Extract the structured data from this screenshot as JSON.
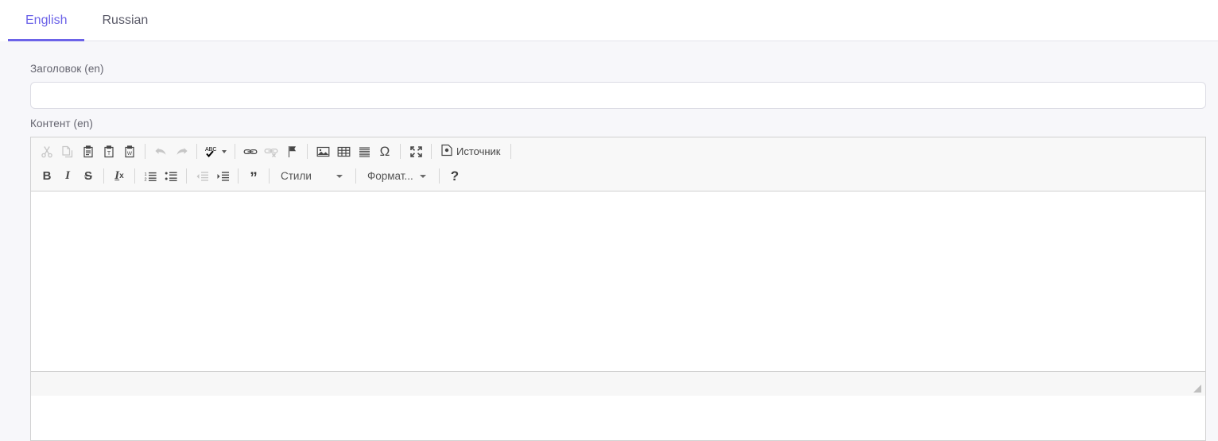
{
  "tabs": [
    {
      "label": "English",
      "active": true
    },
    {
      "label": "Russian",
      "active": false
    }
  ],
  "form": {
    "title_label": "Заголовок (en)",
    "title_value": "",
    "title_placeholder": "",
    "content_label": "Контент (en)"
  },
  "editor": {
    "toolbar_row1": [
      {
        "name": "cut-icon",
        "tooltip": "Вырезать",
        "disabled": true
      },
      {
        "name": "copy-icon",
        "tooltip": "Копировать",
        "disabled": true
      },
      {
        "name": "paste-icon",
        "tooltip": "Вставить",
        "disabled": false
      },
      {
        "name": "paste-as-text-icon",
        "tooltip": "Вставить только текст",
        "disabled": false
      },
      {
        "name": "paste-from-word-icon",
        "tooltip": "Вставить из Word",
        "disabled": false
      },
      {
        "name": "undo-icon",
        "tooltip": "Отменить",
        "disabled": true
      },
      {
        "name": "redo-icon",
        "tooltip": "Повторить",
        "disabled": true
      },
      {
        "name": "spellcheck-icon",
        "tooltip": "Проверить орфографию",
        "disabled": false
      },
      {
        "name": "link-icon",
        "tooltip": "Вставить/Редактировать ссылку",
        "disabled": false
      },
      {
        "name": "unlink-icon",
        "tooltip": "Убрать ссылку",
        "disabled": true
      },
      {
        "name": "anchor-icon",
        "tooltip": "Якорь",
        "disabled": false
      },
      {
        "name": "image-icon",
        "tooltip": "Изображение",
        "disabled": false
      },
      {
        "name": "table-icon",
        "tooltip": "Таблица",
        "disabled": false
      },
      {
        "name": "horizontal-rule-icon",
        "tooltip": "Горизонтальная линия",
        "disabled": false
      },
      {
        "name": "special-char-icon",
        "tooltip": "Вставить спецсимвол",
        "disabled": false
      },
      {
        "name": "maximize-icon",
        "tooltip": "Развернуть",
        "disabled": false
      }
    ],
    "source_button_label": "Источник",
    "toolbar_row2": [
      {
        "name": "bold-icon",
        "tooltip": "Полужирный",
        "disabled": false
      },
      {
        "name": "italic-icon",
        "tooltip": "Курсив",
        "disabled": false
      },
      {
        "name": "strikethrough-icon",
        "tooltip": "Зачеркнутый",
        "disabled": false
      },
      {
        "name": "remove-format-icon",
        "tooltip": "Убрать форматирование",
        "disabled": false
      },
      {
        "name": "numbered-list-icon",
        "tooltip": "Нумерованный список",
        "disabled": false
      },
      {
        "name": "bulleted-list-icon",
        "tooltip": "Маркированный список",
        "disabled": false
      },
      {
        "name": "outdent-icon",
        "tooltip": "Уменьшить отступ",
        "disabled": true
      },
      {
        "name": "indent-icon",
        "tooltip": "Увеличить отступ",
        "disabled": false
      },
      {
        "name": "blockquote-icon",
        "tooltip": "Цитата",
        "disabled": false
      }
    ],
    "styles_combo_label": "Стили",
    "format_combo_label": "Формат...",
    "help_button_label": "?",
    "body_text": "",
    "elements_path": ""
  },
  "colors": {
    "accent": "#6c63e8",
    "page_bg": "#f7f7fa",
    "toolbar_bg": "#f8f8f8",
    "border": "#d1d1d1",
    "input_border": "#dcdce4",
    "icon": "#474747",
    "icon_disabled": "#c6c6c6",
    "label_text": "#64646f"
  }
}
